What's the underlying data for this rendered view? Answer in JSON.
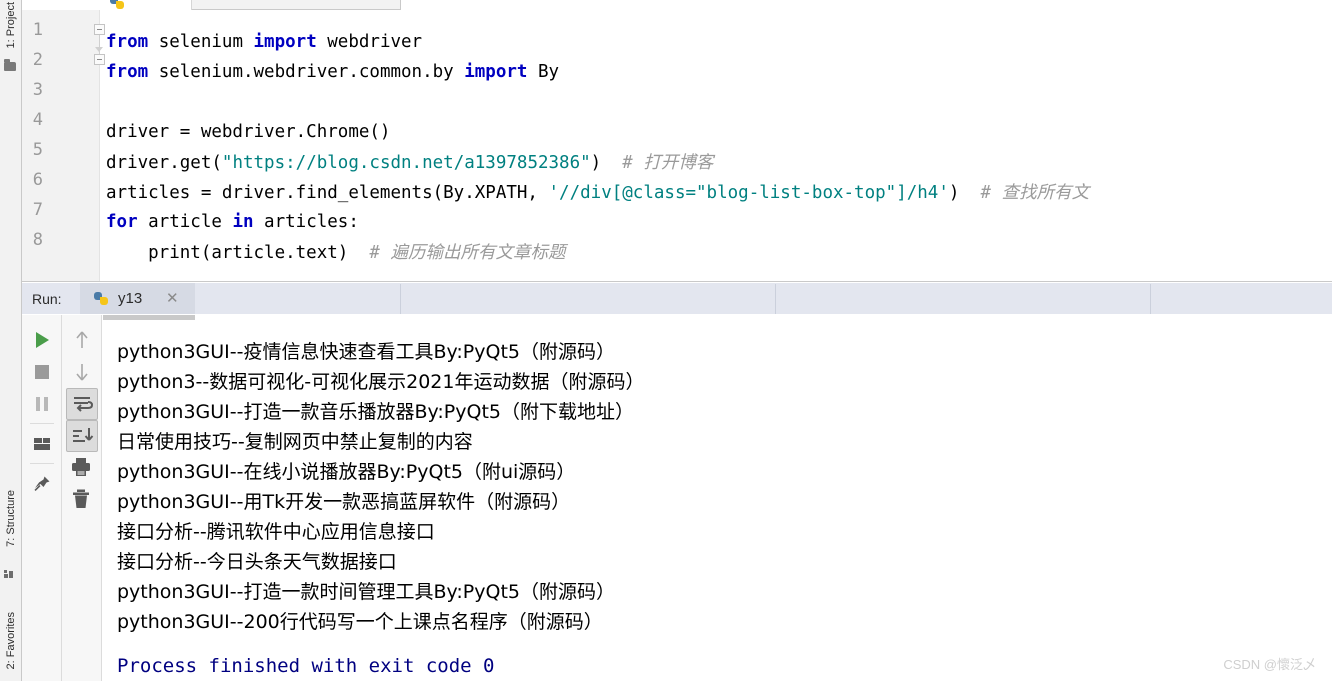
{
  "window": {
    "ide": "PyCharm"
  },
  "left_strip": {
    "items": [
      {
        "label": "1: Project",
        "icon": "folder-icon"
      },
      {
        "label": "7: Structure",
        "icon": "structure-icon"
      },
      {
        "label": "2: Favorites",
        "icon": "favorites-icon"
      }
    ]
  },
  "editor": {
    "line_numbers": [
      "1",
      "2",
      "3",
      "4",
      "5",
      "6",
      "7",
      "8"
    ],
    "lines": [
      {
        "n": 1,
        "segments": [
          {
            "t": "from",
            "c": "kw"
          },
          {
            "t": " selenium ",
            "c": ""
          },
          {
            "t": "import",
            "c": "kw"
          },
          {
            "t": " webdriver",
            "c": ""
          }
        ]
      },
      {
        "n": 2,
        "segments": [
          {
            "t": "from",
            "c": "kw"
          },
          {
            "t": " selenium.webdriver.common.by ",
            "c": ""
          },
          {
            "t": "import",
            "c": "kw"
          },
          {
            "t": " By",
            "c": ""
          }
        ]
      },
      {
        "n": 3,
        "segments": []
      },
      {
        "n": 4,
        "segments": [
          {
            "t": "driver = webdriver.Chrome()",
            "c": ""
          }
        ]
      },
      {
        "n": 5,
        "segments": [
          {
            "t": "driver.get(",
            "c": ""
          },
          {
            "t": "\"https://blog.csdn.net/a1397852386\"",
            "c": "str"
          },
          {
            "t": ")  ",
            "c": ""
          },
          {
            "t": "# ",
            "c": "cmt"
          },
          {
            "t": "打开博客",
            "c": "cmt-cn"
          }
        ]
      },
      {
        "n": 6,
        "segments": [
          {
            "t": "articles = driver.find_elements(By.XPATH, ",
            "c": ""
          },
          {
            "t": "'//div[@class=\"blog-list-box-top\"]/h4'",
            "c": "str"
          },
          {
            "t": ")  ",
            "c": ""
          },
          {
            "t": "# ",
            "c": "cmt"
          },
          {
            "t": "查找所有文",
            "c": "cmt-cn"
          }
        ]
      },
      {
        "n": 7,
        "segments": [
          {
            "t": "for",
            "c": "kw"
          },
          {
            "t": " article ",
            "c": ""
          },
          {
            "t": "in",
            "c": "kw"
          },
          {
            "t": " articles:",
            "c": ""
          }
        ]
      },
      {
        "n": 8,
        "segments": [
          {
            "t": "    print(article.text)  ",
            "c": ""
          },
          {
            "t": "# ",
            "c": "cmt"
          },
          {
            "t": "遍历输出所有文章标题",
            "c": "cmt-cn"
          }
        ]
      }
    ]
  },
  "run_panel": {
    "label": "Run:",
    "tab": {
      "name": "y13",
      "close": "✕",
      "icon": "python-file-icon"
    },
    "left_toolbar": [
      {
        "name": "rerun-button",
        "icon": "run-icon",
        "tooltip": "Rerun"
      },
      {
        "name": "stop-button",
        "icon": "stop-icon",
        "tooltip": "Stop"
      },
      {
        "name": "pause-button",
        "icon": "pause-icon",
        "tooltip": "Pause Output"
      },
      {
        "name": "layout-button",
        "icon": "layout-icon",
        "tooltip": "Layout"
      },
      {
        "name": "pin-button",
        "icon": "pin-icon",
        "tooltip": "Pin Tab"
      }
    ],
    "second_toolbar": [
      {
        "name": "up-button",
        "icon": "arrow-up-icon",
        "tooltip": "Up the Stack Trace"
      },
      {
        "name": "down-button",
        "icon": "arrow-down-icon",
        "tooltip": "Down the Stack Trace"
      },
      {
        "name": "soft-wrap-button",
        "icon": "soft-wrap-icon",
        "tooltip": "Soft-Wrap",
        "pressed": true
      },
      {
        "name": "scroll-end-button",
        "icon": "scroll-to-end-icon",
        "tooltip": "Scroll to the end",
        "pressed": true
      },
      {
        "name": "print-button",
        "icon": "print-icon",
        "tooltip": "Print"
      },
      {
        "name": "clear-button",
        "icon": "trash-icon",
        "tooltip": "Clear All"
      }
    ]
  },
  "console": {
    "output_lines": [
      "python3GUI--疫情信息快速查看工具By:PyQt5（附源码）",
      "python3--数据可视化-可视化展示2021年运动数据（附源码）",
      "python3GUI--打造一款音乐播放器By:PyQt5（附下载地址）",
      "日常使用技巧--复制网页中禁止复制的内容",
      "python3GUI--在线小说播放器By:PyQt5（附ui源码）",
      "python3GUI--用Tk开发一款恶搞蓝屏软件（附源码）",
      "接口分析--腾讯软件中心应用信息接口",
      "接口分析--今日头条天气数据接口",
      "python3GUI--打造一款时间管理工具By:PyQt5（附源码）",
      "python3GUI--200行代码写一个上课点名程序（附源码）"
    ],
    "exit_message": "Process finished with exit code 0"
  },
  "watermark": "CSDN @懷泛乄",
  "colors": {
    "keyword": "#0000c0",
    "string": "#008080",
    "comment": "#9a9a9a",
    "exit_message": "#000080",
    "run_header_bg": "#e3e6ef",
    "run_tab_bg": "#d6dae4",
    "run_icon_green": "#4a9d4a"
  }
}
